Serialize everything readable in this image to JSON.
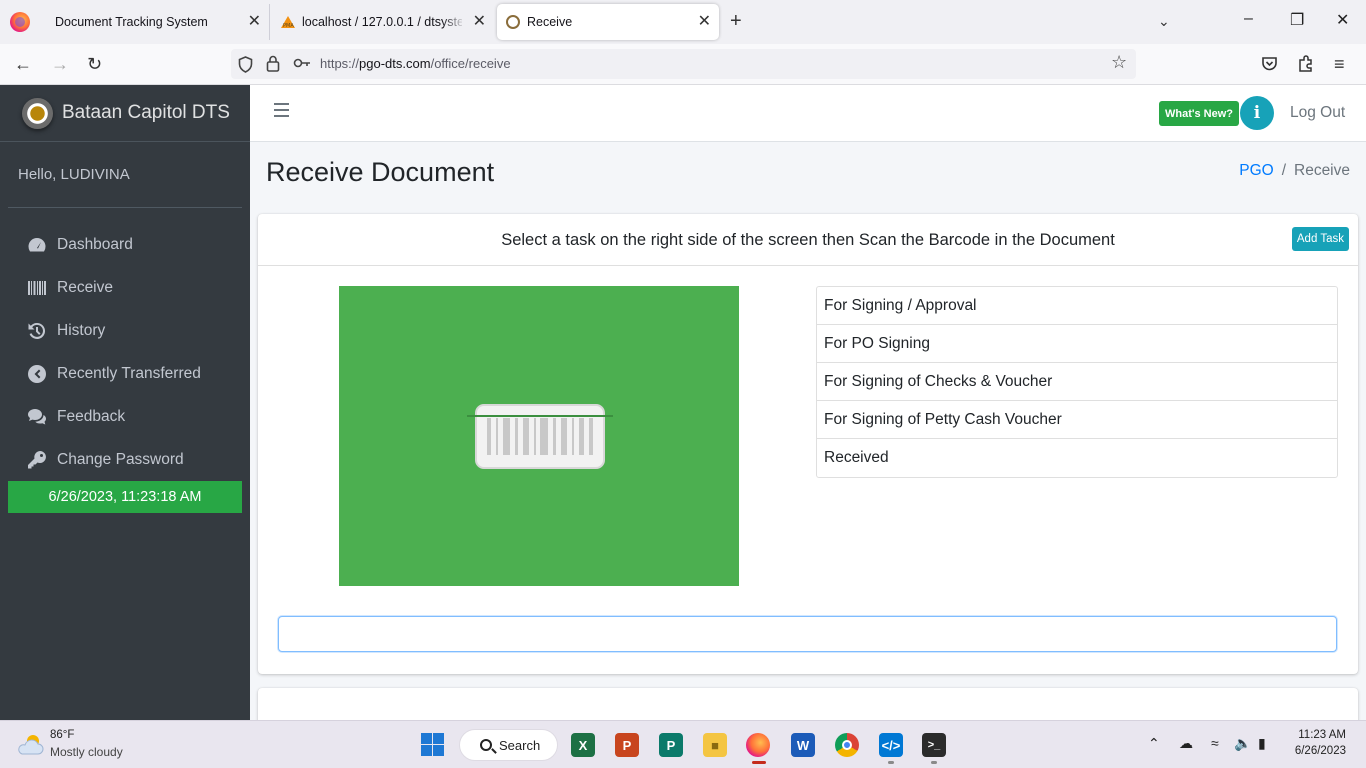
{
  "browser": {
    "tabs": [
      {
        "title": "Document Tracking System",
        "close": "✕"
      },
      {
        "title": "localhost / 127.0.0.1 / dtsystem",
        "close": "✕"
      },
      {
        "title": "Receive",
        "close": "✕"
      }
    ],
    "url_scheme": "https://",
    "url_host": "pgo-dts.com",
    "url_path": "/office/receive"
  },
  "sidebar": {
    "brand": "Bataan Capitol DTS",
    "greeting": "Hello, LUDIVINA",
    "menu": [
      {
        "label": "Dashboard",
        "icon": "dashboard-icon"
      },
      {
        "label": "Receive",
        "icon": "barcode-icon"
      },
      {
        "label": "History",
        "icon": "history-icon"
      },
      {
        "label": "Recently Transferred",
        "icon": "chevron-left-circle-icon"
      },
      {
        "label": "Feedback",
        "icon": "comments-icon"
      },
      {
        "label": "Change Password",
        "icon": "key-icon"
      }
    ],
    "datetime": "6/26/2023, 11:23:18 AM"
  },
  "header": {
    "whats_new": "What's New?",
    "info": "i",
    "logout": "Log Out"
  },
  "page": {
    "title": "Receive Document",
    "breadcrumb": {
      "parent": "PGO",
      "separator": "/",
      "current": "Receive"
    }
  },
  "card": {
    "instruction": "Select a task on the right side of the screen then Scan the Barcode in the Document",
    "add_task": "Add Task",
    "tasks": [
      "For Signing / Approval",
      "For PO Signing",
      "For Signing of Checks & Voucher",
      "For Signing of Petty Cash Voucher",
      "Received"
    ],
    "barcode_input_value": "",
    "colors": {
      "scanner_bg": "#4caf50",
      "accent": "#17a2b8",
      "success": "#28a745"
    }
  },
  "taskbar": {
    "weather_temp": "86°F",
    "weather_desc": "Mostly cloudy",
    "search": "Search",
    "time": "11:23 AM",
    "date": "6/26/2023"
  }
}
